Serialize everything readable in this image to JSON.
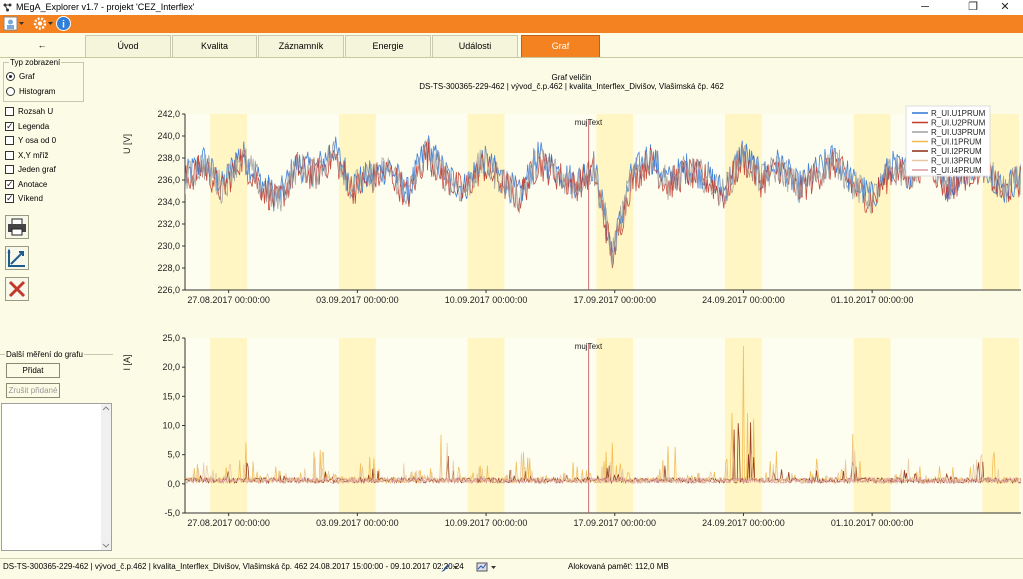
{
  "window": {
    "title": "MEgA_Explorer v1.7 - projekt 'CEZ_Interflex'",
    "minimize_glyph": "─",
    "maximize_glyph": "❐",
    "close_glyph": "✕"
  },
  "tabs": {
    "back": "←",
    "items": [
      "Úvod",
      "Kvalita",
      "Záznamník",
      "Energie",
      "Události",
      "Graf"
    ],
    "active": "Graf"
  },
  "left_panel": {
    "display_type_title": "Typ zobrazení",
    "display_types": [
      "Graf",
      "Histogram"
    ],
    "selected_display_type": "Graf",
    "options": [
      {
        "label": "Rozsah U",
        "checked": false
      },
      {
        "label": "Legenda",
        "checked": true
      },
      {
        "label": "Y osa od 0",
        "checked": false
      },
      {
        "label": "X,Y mříž",
        "checked": false
      },
      {
        "label": "Jeden graf",
        "checked": false
      },
      {
        "label": "Anotace",
        "checked": true
      },
      {
        "label": "Víkend",
        "checked": true
      }
    ],
    "more_measurements_title": "Další měření do grafu",
    "add_button": "Přidat",
    "cancel_added_button": "Zrušit přidané"
  },
  "chart_header": {
    "title": "Graf veličin",
    "subtitle": "DS-TS-300365-229-462 | vývod_č.p.462 | kvalita_Interflex_Divišov, Vlašimská čp. 462"
  },
  "chart_data": [
    {
      "type": "line",
      "ylabel": "U [V]",
      "ylim": [
        226.0,
        242.0
      ],
      "yticks": [
        "242,0",
        "240,0",
        "238,0",
        "236,0",
        "234,0",
        "232,0",
        "230,0",
        "228,0",
        "226,0"
      ],
      "xlim": [
        "2017-08-24 15:00",
        "2017-10-09 02:20"
      ],
      "xticks": [
        "27.08.2017 00:00:00",
        "03.09.2017 00:00:00",
        "10.09.2017 00:00:00",
        "17.09.2017 00:00:00",
        "24.09.2017 00:00:00",
        "01.10.2017 00:00:00"
      ],
      "annotation": {
        "label": "mujText",
        "x": "2017-09-15 14:00"
      },
      "weekend_bands": [
        [
          "2017-08-26",
          "2017-08-28"
        ],
        [
          "2017-09-02",
          "2017-09-04"
        ],
        [
          "2017-09-09",
          "2017-09-11"
        ],
        [
          "2017-09-16",
          "2017-09-18"
        ],
        [
          "2017-09-23",
          "2017-09-25"
        ],
        [
          "2017-09-30",
          "2017-10-02"
        ],
        [
          "2017-10-07",
          "2017-10-09"
        ]
      ],
      "legend": "top-right",
      "series": [
        {
          "name": "R_UI.U1PRUM",
          "color": "#2e75d6",
          "values": [
            236.2,
            237.8,
            235.4,
            238.6,
            236.0,
            234.2,
            237.5,
            236.8,
            238.9,
            235.6,
            236.4,
            237.2,
            234.8,
            239.1,
            236.6,
            235.2,
            237.9,
            236.3,
            234.6,
            238.2,
            236.9,
            235.8,
            237.4,
            229.5,
            236.1,
            238.4,
            235.9,
            237.1,
            236.5,
            234.9,
            238.7,
            236.2,
            237.6,
            235.3,
            236.8,
            238.1,
            235.7,
            234.4,
            237.3,
            236.7,
            238.5,
            235.5,
            236.9,
            237.8,
            235.1,
            236.4
          ]
        },
        {
          "name": "R_UI.U2PRUM",
          "color": "#c0392b",
          "values": [
            235.9,
            237.2,
            235.0,
            238.0,
            235.6,
            233.9,
            237.0,
            236.4,
            238.2,
            235.2,
            236.0,
            236.8,
            234.5,
            238.4,
            236.2,
            234.9,
            237.3,
            235.9,
            234.3,
            237.6,
            236.5,
            235.4,
            236.9,
            229.0,
            235.8,
            237.8,
            235.5,
            236.7,
            236.1,
            234.6,
            238.0,
            235.9,
            237.1,
            235.0,
            236.4,
            237.5,
            235.3,
            234.1,
            236.8,
            236.3,
            237.9,
            235.1,
            236.5,
            237.2,
            234.8,
            236.0
          ]
        },
        {
          "name": "R_UI.U3PRUM",
          "color": "#a0a0a0",
          "values": [
            236.0,
            237.5,
            235.2,
            238.3,
            235.8,
            234.0,
            237.2,
            236.6,
            238.5,
            235.4,
            236.2,
            237.0,
            234.6,
            238.7,
            236.4,
            235.0,
            237.6,
            236.1,
            234.4,
            237.9,
            236.7,
            235.6,
            237.1,
            229.3,
            236.0,
            238.1,
            235.7,
            236.9,
            236.3,
            234.7,
            238.3,
            236.0,
            237.3,
            235.2,
            236.6,
            237.8,
            235.5,
            234.2,
            237.0,
            236.5,
            238.2,
            235.3,
            236.7,
            237.5,
            234.9,
            236.2
          ]
        },
        {
          "name": "R_UI.I1PRUM",
          "color": "#f2b84b",
          "values": [
            0.5,
            3.2,
            1.1,
            6.4,
            0.8,
            2.5,
            0.4,
            5.1,
            1.3,
            0.6,
            4.2,
            0.9,
            3.6,
            1.0,
            7.2,
            0.7,
            2.8,
            0.5,
            5.6,
            1.2,
            0.6,
            3.4,
            0.8,
            4.8,
            1.1,
            0.5,
            6.1,
            0.9,
            2.2,
            0.7,
            17.5,
            1.0,
            4.5,
            0.6,
            3.0,
            0.8,
            5.9,
            1.2,
            0.5,
            4.0,
            0.9,
            2.7,
            0.6,
            6.6,
            1.0,
            0.7
          ]
        },
        {
          "name": "R_UI.I2PRUM",
          "color": "#8b2a12",
          "values": [
            0.3,
            1.5,
            0.6,
            3.2,
            0.4,
            1.2,
            0.2,
            2.6,
            0.7,
            0.3,
            2.1,
            0.5,
            1.8,
            0.5,
            3.6,
            0.4,
            1.4,
            0.3,
            2.8,
            0.6,
            0.3,
            1.7,
            0.4,
            2.4,
            0.6,
            0.3,
            3.0,
            0.5,
            1.1,
            0.4,
            12.0,
            0.5,
            2.3,
            0.3,
            1.5,
            0.4,
            2.9,
            0.6,
            0.3,
            2.0,
            0.5,
            1.4,
            0.3,
            3.3,
            0.5,
            0.4
          ]
        },
        {
          "name": "R_UI.I3PRUM",
          "color": "#e8c8a0",
          "values": [
            0.4,
            2.4,
            0.8,
            4.8,
            0.6,
            1.9,
            0.3,
            3.8,
            1.0,
            0.5,
            3.1,
            0.7,
            2.7,
            0.8,
            5.4,
            0.5,
            2.1,
            0.4,
            4.2,
            0.9,
            0.5,
            2.5,
            0.6,
            3.6,
            0.8,
            0.4,
            4.6,
            0.7,
            1.6,
            0.5,
            9.0,
            0.8,
            3.4,
            0.5,
            2.2,
            0.6,
            4.4,
            0.9,
            0.4,
            3.0,
            0.7,
            2.0,
            0.5,
            4.9,
            0.8,
            0.5
          ]
        },
        {
          "name": "R_UI.I4PRUM",
          "color": "#d99aa0",
          "values": [
            0.1,
            0.3,
            0.1,
            0.5,
            0.1,
            0.2,
            0.1,
            0.4,
            0.1,
            0.1,
            0.3,
            0.1,
            0.3,
            0.1,
            0.6,
            0.1,
            0.2,
            0.1,
            0.4,
            0.1,
            0.1,
            0.3,
            0.1,
            0.4,
            0.1,
            0.1,
            0.5,
            0.1,
            0.2,
            0.1,
            0.8,
            0.1,
            0.3,
            0.1,
            0.2,
            0.1,
            0.4,
            0.1,
            0.1,
            0.3,
            0.1,
            0.2,
            0.1,
            0.5,
            0.1,
            0.1
          ]
        }
      ]
    },
    {
      "type": "line",
      "ylabel": "I [A]",
      "ylim": [
        -5.0,
        25.0
      ],
      "yticks": [
        "25,0",
        "20,0",
        "15,0",
        "10,0",
        "5,0",
        "0,0",
        "-5,0"
      ],
      "xlim": [
        "2017-08-24 15:00",
        "2017-10-09 02:20"
      ],
      "xticks": [
        "27.08.2017 00:00:00",
        "03.09.2017 00:00:00",
        "10.09.2017 00:00:00",
        "17.09.2017 00:00:00",
        "24.09.2017 00:00:00",
        "01.10.2017 00:00:00"
      ],
      "annotation": {
        "label": "mujText",
        "x": "2017-09-15 14:00"
      }
    }
  ],
  "status": {
    "text": "DS-TS-300365-229-462 | vývod_č.p.462 | kvalita_Interflex_Divišov, Vlašimská čp. 462  24.08.2017 15:00:00 - 09.10.2017 02:20:24",
    "memory": "Alokovaná paměť: 112,0 MB"
  }
}
